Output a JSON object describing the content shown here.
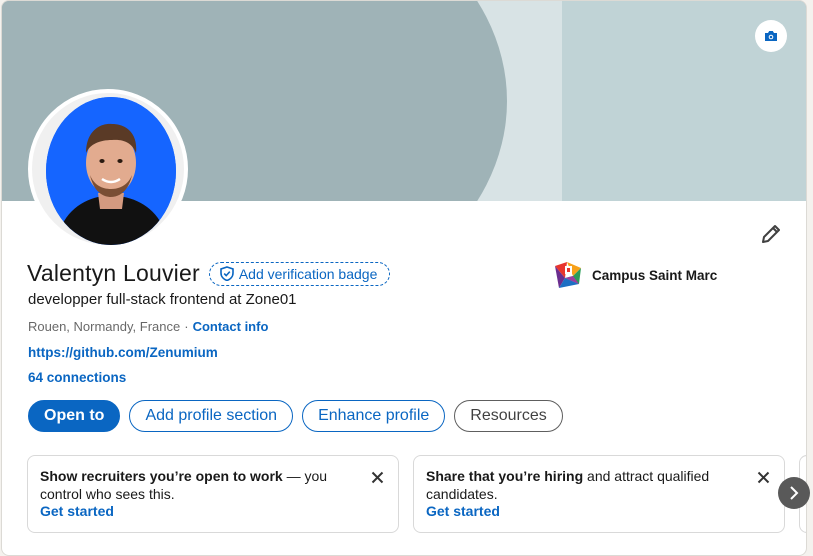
{
  "profile": {
    "name": "Valentyn Louvier",
    "verify_label": "Add verification badge",
    "headline": "developper full-stack frontend at Zone01",
    "location": "Rouen, Normandy, France",
    "separator": "·",
    "contact_label": "Contact info",
    "website": "https://github.com/Zenumium",
    "connections": "64 connections"
  },
  "company": {
    "name": "Campus Saint Marc",
    "logo_icon": "campus-logo-icon"
  },
  "actions": {
    "open_to": "Open to",
    "add_section": "Add profile section",
    "enhance": "Enhance profile",
    "resources": "Resources"
  },
  "tips": [
    {
      "bold": "Show recruiters you’re open to work",
      "rest": " — you control who sees this.",
      "cta": "Get started"
    },
    {
      "bold": "Share that you’re hiring",
      "rest": " and attract qualified candidates.",
      "cta": "Get started"
    }
  ],
  "icons": {
    "camera": "camera-icon",
    "edit": "pencil-icon",
    "shield": "shield-check-icon",
    "close": "close-icon",
    "next": "chevron-right-icon"
  },
  "colors": {
    "accent": "#0a66c2",
    "avatar_bg": "#1565ff",
    "banner": "#9fb3b7"
  }
}
